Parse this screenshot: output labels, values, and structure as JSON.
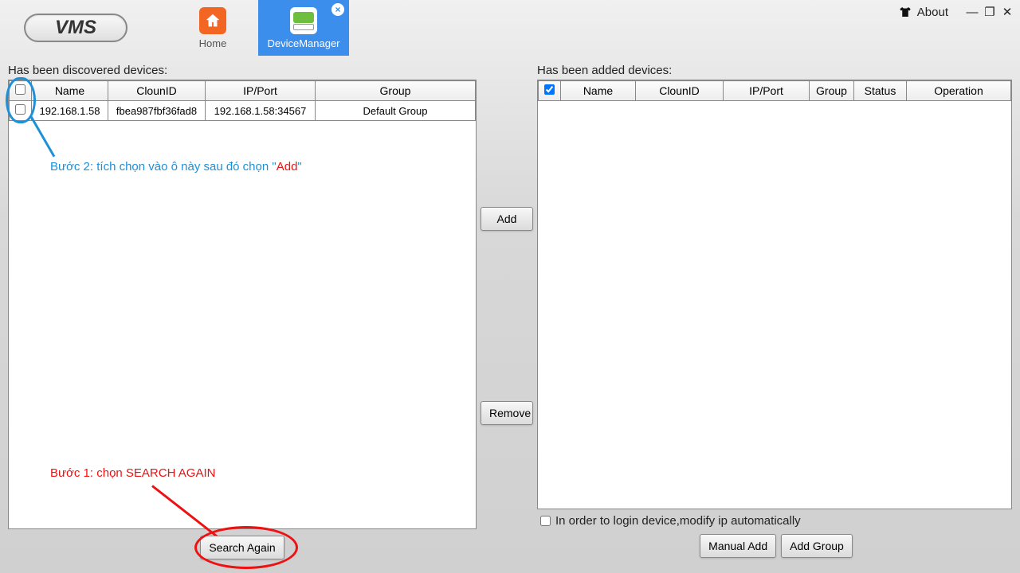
{
  "app": {
    "logo_text": "VMS"
  },
  "tabs": {
    "home_label": "Home",
    "dm_label": "DeviceManager"
  },
  "window": {
    "about_label": "About"
  },
  "left": {
    "title": "Has been discovered devices:",
    "headers": {
      "name": "Name",
      "clounid": "ClounID",
      "ipport": "IP/Port",
      "group": "Group"
    },
    "row": {
      "name": "192.168.1.58",
      "clounid": "fbea987fbf36fad8",
      "ipport": "192.168.1.58:34567",
      "group": "Default Group"
    },
    "search_again": "Search Again"
  },
  "mid": {
    "add": "Add",
    "remove": "Remove"
  },
  "right": {
    "title": "Has been added devices:",
    "headers": {
      "name": "Name",
      "clounid": "ClounID",
      "ipport": "IP/Port",
      "group": "Group",
      "status": "Status",
      "operation": "Operation"
    },
    "auto_label": "In order to login device,modify ip automatically",
    "manual_add": "Manual Add",
    "add_group": "Add Group"
  },
  "annotations": {
    "step2_pre": "Bước 2: tích chọn vào ô này sau đó chọn \"",
    "step2_add": "Add",
    "step2_post": "\"",
    "step1": "Bước 1: chọn SEARCH AGAIN"
  }
}
